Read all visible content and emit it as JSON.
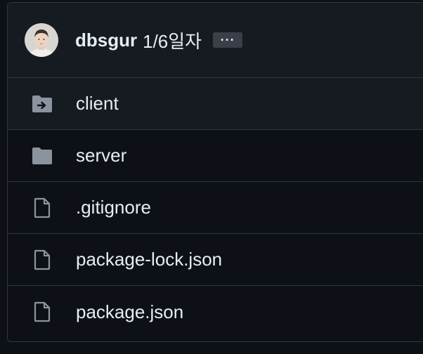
{
  "commit": {
    "author": "dbsgur",
    "message": "1/6일자",
    "more_label": "···"
  },
  "files": [
    {
      "name": "client",
      "icon": "folder-submodule-icon"
    },
    {
      "name": "server",
      "icon": "folder-icon"
    },
    {
      "name": ".gitignore",
      "icon": "file-icon"
    },
    {
      "name": "package-lock.json",
      "icon": "file-icon"
    },
    {
      "name": "package.json",
      "icon": "file-icon"
    }
  ],
  "colors": {
    "background": "#0d1117",
    "header_background": "#161b22",
    "border": "#30363d",
    "text": "#e6edf3",
    "icon": "#8b949e"
  }
}
